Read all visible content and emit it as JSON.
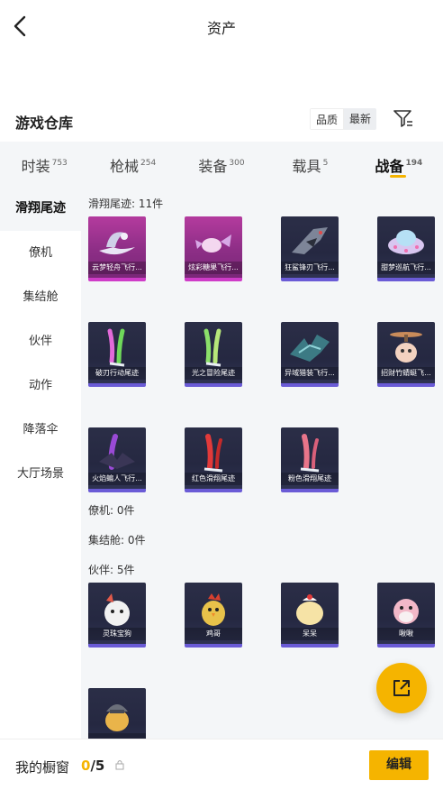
{
  "header": {
    "title": "资产"
  },
  "warehouse": {
    "title": "游戏仓库",
    "sort_quality": "品质",
    "sort_newest": "最新"
  },
  "tabs": [
    {
      "label": "时装",
      "count": "753",
      "active": false
    },
    {
      "label": "枪械",
      "count": "254",
      "active": false
    },
    {
      "label": "装备",
      "count": "300",
      "active": false
    },
    {
      "label": "载具",
      "count": "5",
      "active": false
    },
    {
      "label": "战备",
      "count": "194",
      "active": true
    }
  ],
  "sidebar": {
    "items": [
      {
        "label": "滑翔尾迹",
        "active": true
      },
      {
        "label": "僚机",
        "active": false
      },
      {
        "label": "集结舱",
        "active": false
      },
      {
        "label": "伙伴",
        "active": false
      },
      {
        "label": "动作",
        "active": false
      },
      {
        "label": "降落伞",
        "active": false
      },
      {
        "label": "大厅场景",
        "active": false
      }
    ]
  },
  "sections": [
    {
      "label": "滑翔尾迹: 11件"
    },
    {
      "label": "僚机: 0件"
    },
    {
      "label": "集结舱: 0件"
    },
    {
      "label": "伙伴: 5件"
    }
  ],
  "items": [
    {
      "name": "云梦轻舟飞行...",
      "rarity": "pink",
      "icon": "boat-glider-icon"
    },
    {
      "name": "炫彩糖果飞行...",
      "rarity": "pink",
      "icon": "candy-glider-icon"
    },
    {
      "name": "狂鲨锋刃飞行...",
      "rarity": "purple",
      "icon": "shark-glider-icon"
    },
    {
      "name": "甜梦巡航飞行...",
      "rarity": "purple",
      "icon": "ufo-glider-icon"
    },
    {
      "name": "破刃行动尾迹",
      "rarity": "purple",
      "icon": "trail-rainbow-icon"
    },
    {
      "name": "光之冒险尾迹",
      "rarity": "purple",
      "icon": "trail-green-icon"
    },
    {
      "name": "异域猎装飞行...",
      "rarity": "purple",
      "icon": "dragon-glider-icon"
    },
    {
      "name": "招财竹蜻蜓飞...",
      "rarity": "purple",
      "icon": "propeller-glider-icon"
    },
    {
      "name": "火焰蝙人飞行...",
      "rarity": "purple",
      "icon": "bat-glider-icon"
    },
    {
      "name": "红色滑翔尾迹",
      "rarity": "purple",
      "icon": "trail-red-icon"
    },
    {
      "name": "粉色滑翔尾迹",
      "rarity": "purple",
      "icon": "trail-pink-icon"
    }
  ],
  "partners": [
    {
      "name": "灵珠宝狗",
      "icon": "dog-partner-icon"
    },
    {
      "name": "鸡哥",
      "icon": "chicken-partner-icon"
    },
    {
      "name": "呆呆",
      "icon": "chick-partner-icon"
    },
    {
      "name": "啾啾",
      "icon": "bird-partner-icon"
    },
    {
      "name": "",
      "icon": "knight-duck-partner-icon"
    }
  ],
  "bottom": {
    "label": "我的橱窗",
    "current": "0",
    "total": "/5",
    "edit": "编辑"
  },
  "colors": {
    "accent": "#f5b400",
    "pink_card": "#b43b9e",
    "purple_card": "#2b2e47"
  }
}
